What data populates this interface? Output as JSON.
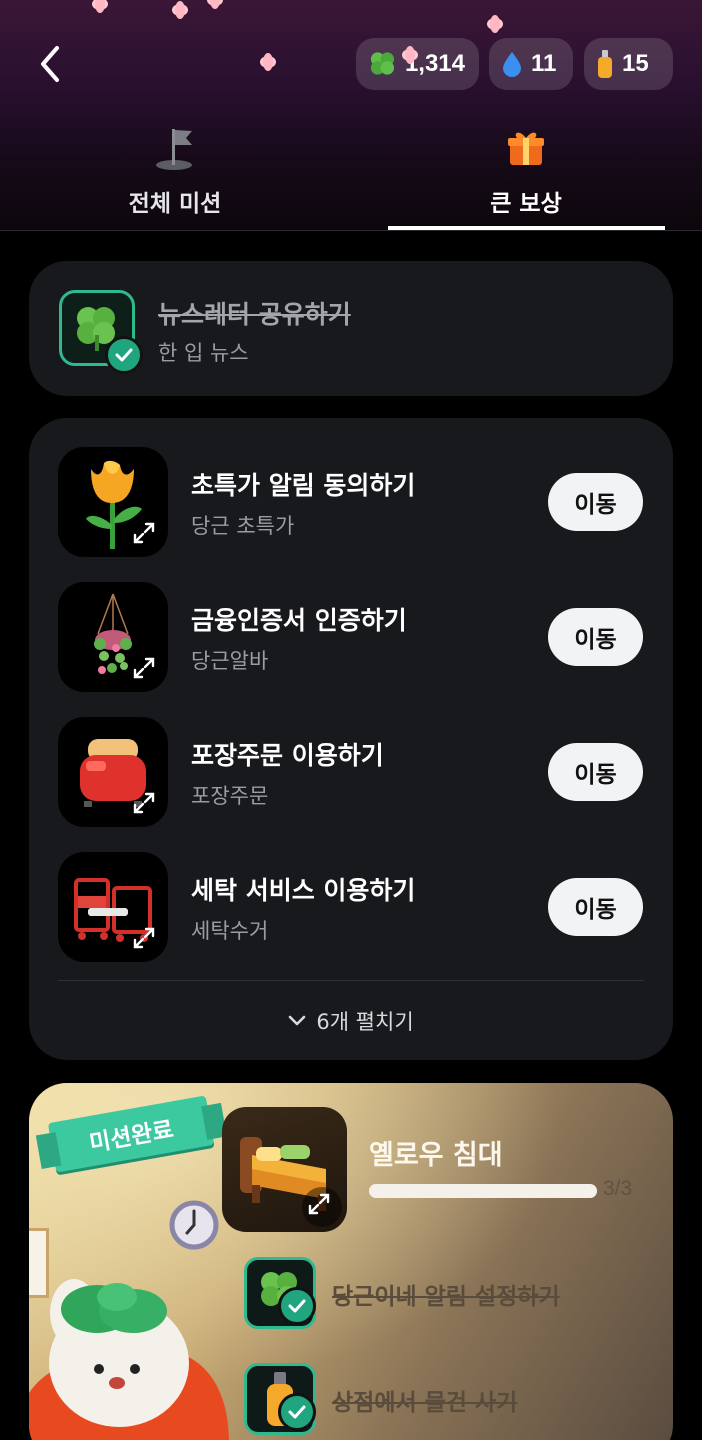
{
  "header": {
    "currencies": [
      {
        "icon": "clover-icon",
        "value": "1,314"
      },
      {
        "icon": "water-drop-icon",
        "value": "11"
      },
      {
        "icon": "bottle-icon",
        "value": "15"
      }
    ],
    "tabs": [
      {
        "label": "전체 미션",
        "icon": "flag-icon",
        "active": false
      },
      {
        "label": "큰 보상",
        "icon": "gift-icon",
        "active": true
      }
    ]
  },
  "completed_mission": {
    "title": "뉴스레터 공유하기",
    "subtitle": "한 입 뉴스",
    "icon": "clover-icon"
  },
  "missions": [
    {
      "title": "초특가 알림 동의하기",
      "subtitle": "당근 초특가",
      "icon": "tulip-icon",
      "button": "이동"
    },
    {
      "title": "금융인증서 인증하기",
      "subtitle": "당근알바",
      "icon": "hanging-plant-icon",
      "button": "이동"
    },
    {
      "title": "포장주문 이용하기",
      "subtitle": "포장주문",
      "icon": "toaster-icon",
      "button": "이동"
    },
    {
      "title": "세탁 서비스 이용하기",
      "subtitle": "세탁수거",
      "icon": "laundry-cart-icon",
      "button": "이동"
    }
  ],
  "expand_label": "6개 펼치기",
  "reward": {
    "badge": "미션완료",
    "title": "옐로우 침대",
    "progress_text": "3/3",
    "progress": 1.0,
    "icon": "bed-icon",
    "sub_missions": [
      {
        "label": "당근이네 알림 설정하기",
        "icon": "clover-icon",
        "done": true
      },
      {
        "label": "상점에서 물건 사기",
        "icon": "bottle-icon",
        "done": true
      }
    ]
  },
  "colors": {
    "accent_green": "#1fa67f",
    "card_bg": "#18191c",
    "header_top": "#3a1636"
  }
}
